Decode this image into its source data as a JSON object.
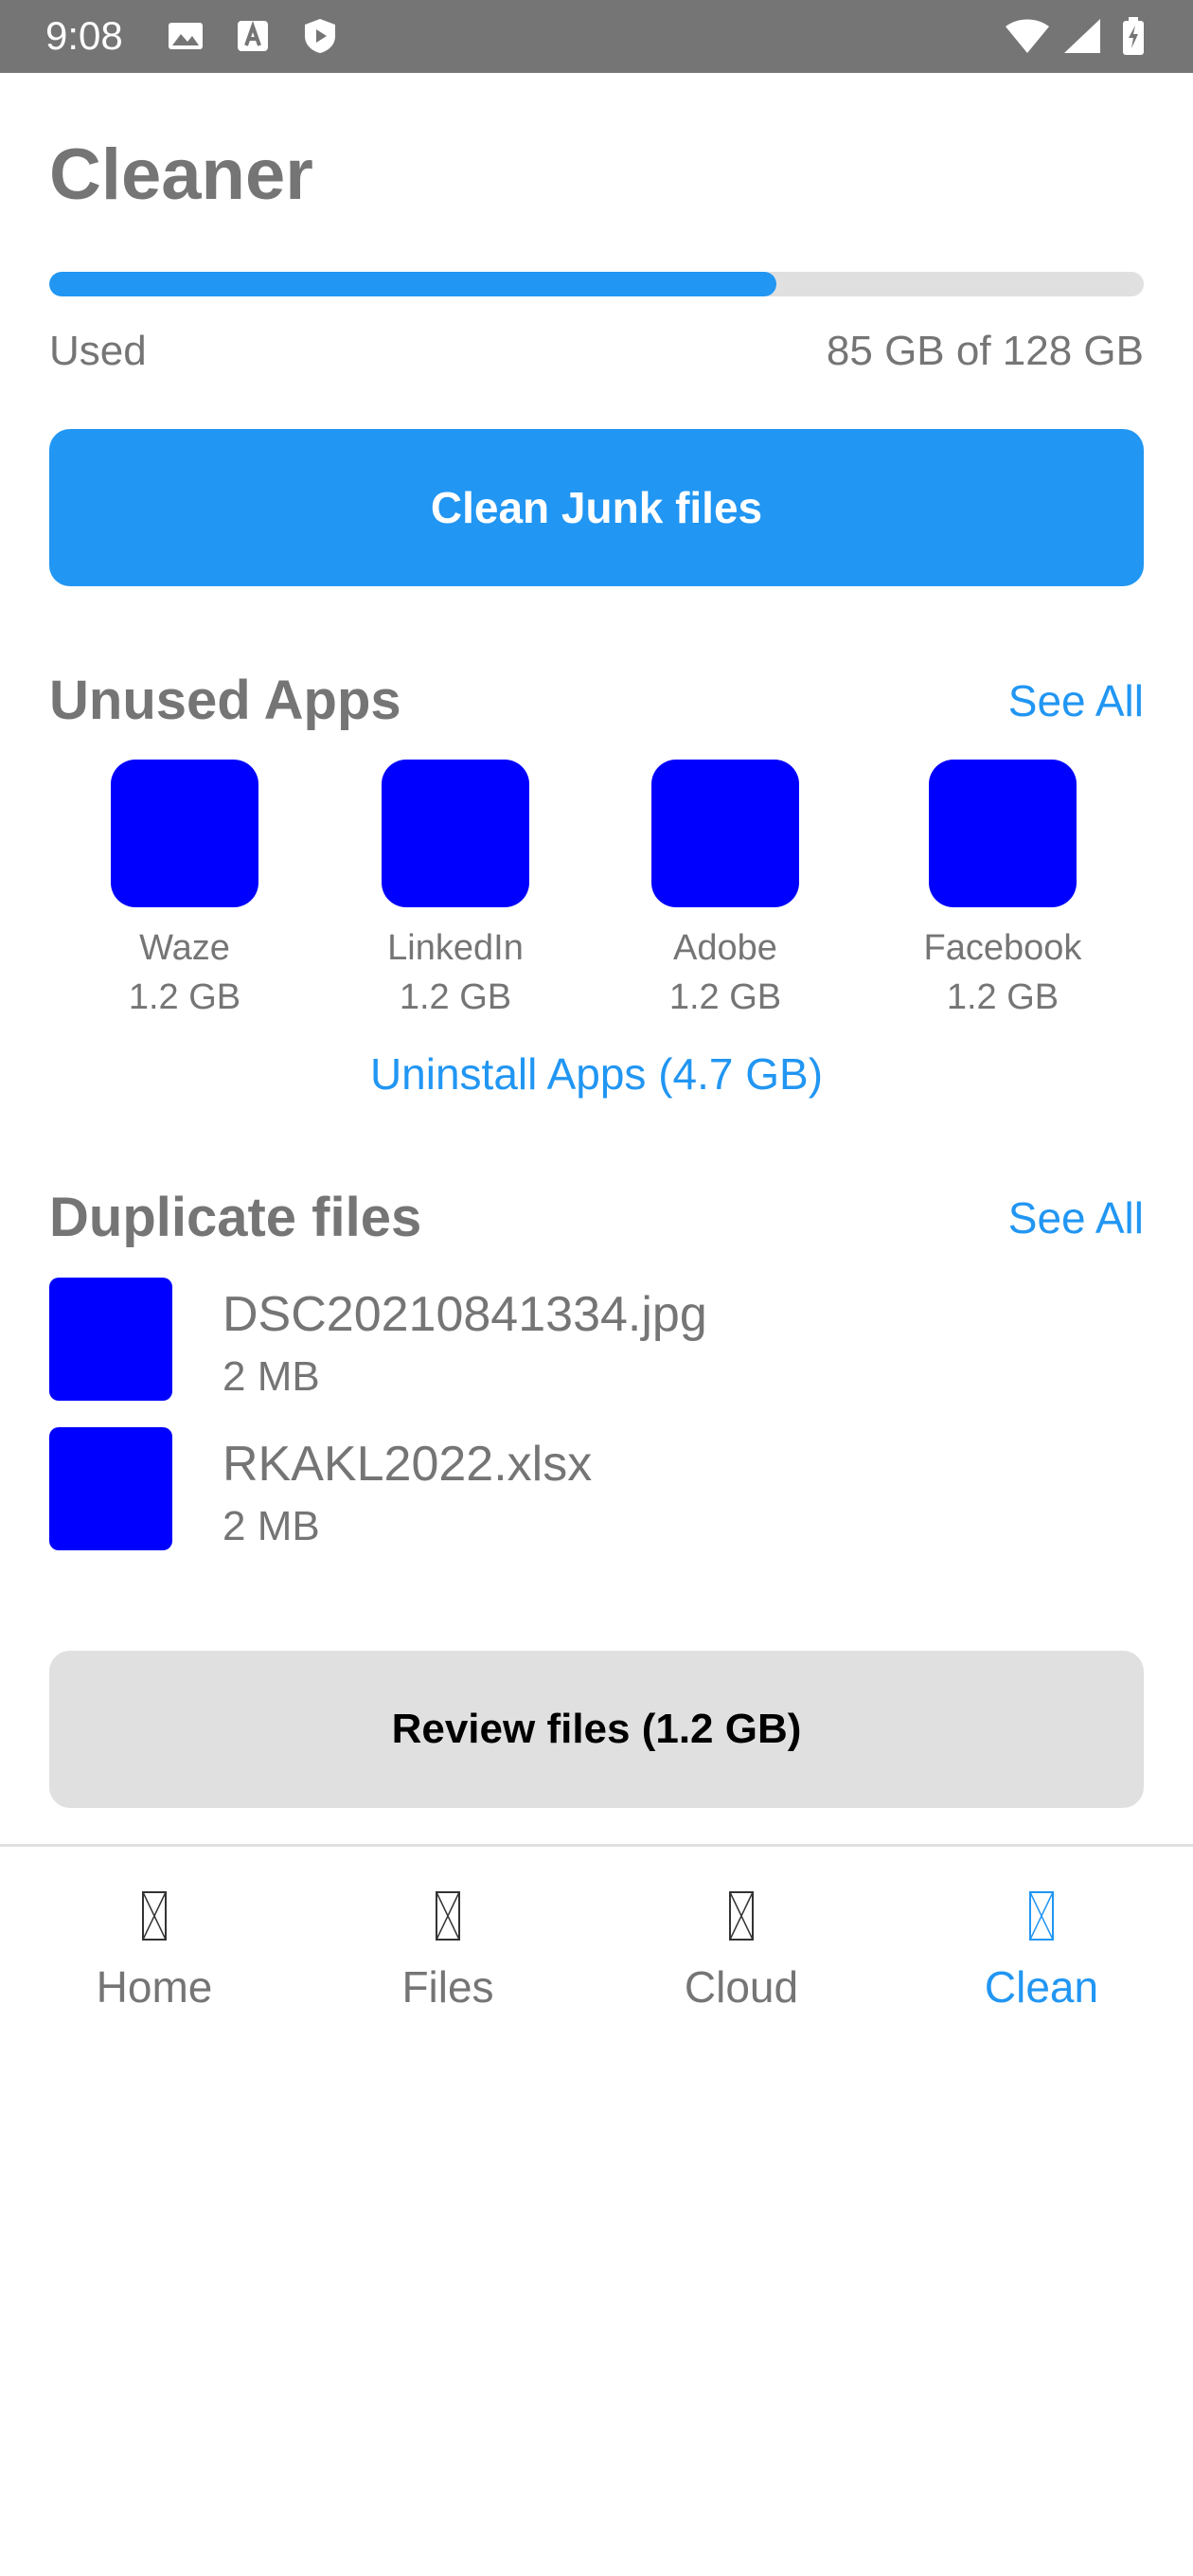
{
  "status_bar": {
    "time": "9:08",
    "left_icons": [
      "image-icon",
      "font-icon",
      "shield-play-icon"
    ],
    "right_icons": [
      "wifi-icon",
      "signal-icon",
      "battery-icon"
    ]
  },
  "header": {
    "title": "Cleaner"
  },
  "storage": {
    "used_label": "Used",
    "used_value": "85 GB of 128 GB",
    "used_fraction": 0.664
  },
  "primary_action": {
    "label": "Clean Junk files"
  },
  "unused_apps": {
    "title": "Unused Apps",
    "see_all": "See All",
    "apps": [
      {
        "name": "Waze",
        "size": "1.2 GB"
      },
      {
        "name": "LinkedIn",
        "size": "1.2 GB"
      },
      {
        "name": "Adobe",
        "size": "1.2 GB"
      },
      {
        "name": "Facebook",
        "size": "1.2 GB"
      }
    ],
    "uninstall_label": "Uninstall Apps (4.7 GB)"
  },
  "duplicate_files": {
    "title": "Duplicate files",
    "see_all": "See All",
    "files": [
      {
        "name": "DSC20210841334.jpg",
        "size": "2 MB"
      },
      {
        "name": "RKAKL2022.xlsx",
        "size": "2 MB"
      }
    ],
    "review_label": "Review files (1.2 GB)"
  },
  "bottom_nav": {
    "items": [
      {
        "label": "Home",
        "icon": "home-icon",
        "active": false
      },
      {
        "label": "Files",
        "icon": "files-icon",
        "active": false
      },
      {
        "label": "Cloud",
        "icon": "cloud-icon",
        "active": false
      },
      {
        "label": "Clean",
        "icon": "clean-icon",
        "active": true
      }
    ]
  },
  "colors": {
    "accent": "#2196f3",
    "status_bar": "#757575",
    "text": "#757575",
    "placeholder_icon": "#0000ff",
    "secondary_button": "#e0e0e0"
  }
}
